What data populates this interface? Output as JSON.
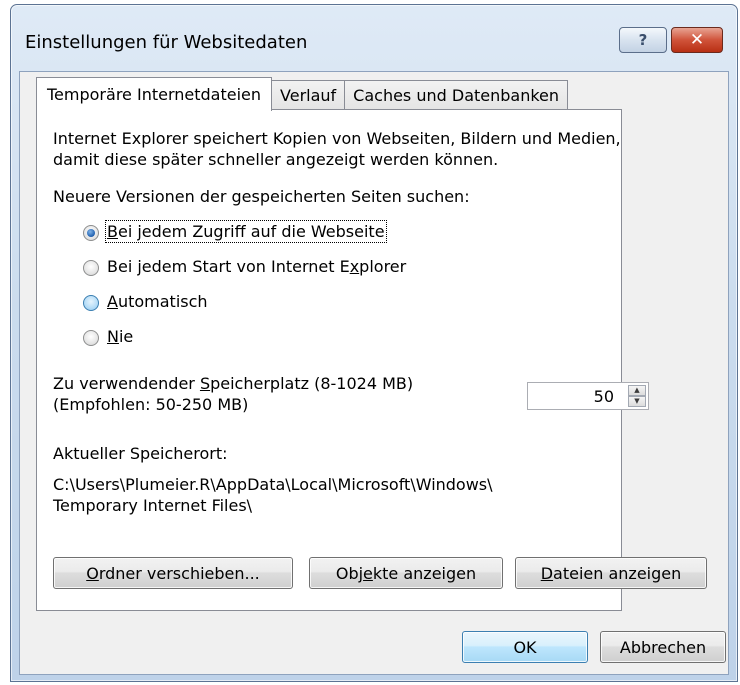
{
  "window": {
    "title": "Einstellungen für Websitedaten",
    "help_label": "?",
    "close_label": "✕"
  },
  "tabs": [
    {
      "label": "Temporäre Internetdateien"
    },
    {
      "label": "Verlauf"
    },
    {
      "label": "Caches und Datenbanken"
    }
  ],
  "page": {
    "intro_line1": "Internet Explorer speichert Kopien von Webseiten, Bildern und Medien,",
    "intro_line2": "damit diese später schneller angezeigt werden können.",
    "check_heading": "Neuere Versionen der gespeicherten Seiten suchen:",
    "options": [
      {
        "pre": "",
        "key": "B",
        "post": "ei jedem Zugriff auf die Webseite",
        "checked": true
      },
      {
        "pre": "Bei jedem Start von Internet E",
        "key": "x",
        "post": "plorer",
        "checked": false
      },
      {
        "pre": "",
        "key": "A",
        "post": "utomatisch",
        "checked": false
      },
      {
        "pre": "",
        "key": "N",
        "post": "ie",
        "checked": false
      }
    ],
    "storage_label_pre": "Zu verwendender ",
    "storage_label_key": "S",
    "storage_label_post": "peicherplatz (8-1024 MB)",
    "storage_recommended": "(Empfohlen: 50-250 MB)",
    "storage_value": "50",
    "location_label": "Aktueller Speicherort:",
    "location_line1": "C:\\Users\\Plumeier.R\\AppData\\Local\\Microsoft\\Windows\\",
    "location_line2": "Temporary Internet Files\\",
    "btn_move_key": "O",
    "btn_move_post": "rdner verschieben...",
    "btn_objects_pre": "Obj",
    "btn_objects_key": "e",
    "btn_objects_post": "kte anzeigen",
    "btn_files_key": "D",
    "btn_files_post": "ateien anzeigen"
  },
  "footer": {
    "ok_label": "OK",
    "cancel_label": "Abbrechen"
  }
}
